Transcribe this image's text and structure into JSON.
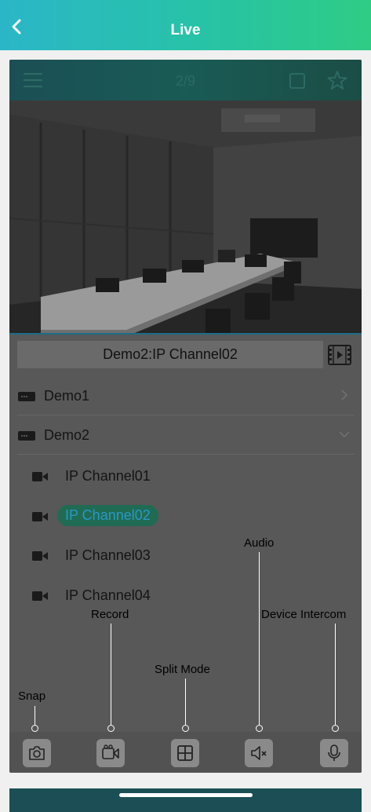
{
  "navbar": {
    "title": "Live",
    "back_icon": "chevron-left-icon"
  },
  "card": {
    "menu_icon": "hamburger-menu-icon",
    "page_indicator": "2/9",
    "split_icon": "square-split-icon",
    "favorite_icon": "star-icon",
    "current_channel": "Demo2:IP Channel02",
    "playback_icon": "film-play-icon"
  },
  "devices": [
    {
      "name": "Demo1",
      "expanded": false,
      "icon": "dvr-icon"
    },
    {
      "name": "Demo2",
      "expanded": true,
      "icon": "dvr-icon"
    }
  ],
  "channels": [
    {
      "name": "IP Channel01",
      "selected": false
    },
    {
      "name": "IP Channel02",
      "selected": true
    },
    {
      "name": "IP Channel03",
      "selected": false
    },
    {
      "name": "IP Channel04",
      "selected": false
    }
  ],
  "callouts": {
    "snap": "Snap",
    "record": "Record",
    "split_mode": "Split Mode",
    "audio": "Audio",
    "device_intercom": "Device Intercom"
  },
  "toolbar_icons": [
    "camera-icon",
    "video-record-icon",
    "grid-icon",
    "speaker-mute-icon",
    "microphone-icon"
  ],
  "colors": {
    "nav_gradient_start": "#2bb6c8",
    "nav_gradient_end": "#2fcc85",
    "selected_channel_bg": "#1f6b54",
    "selected_channel_text": "#2a98c4"
  }
}
